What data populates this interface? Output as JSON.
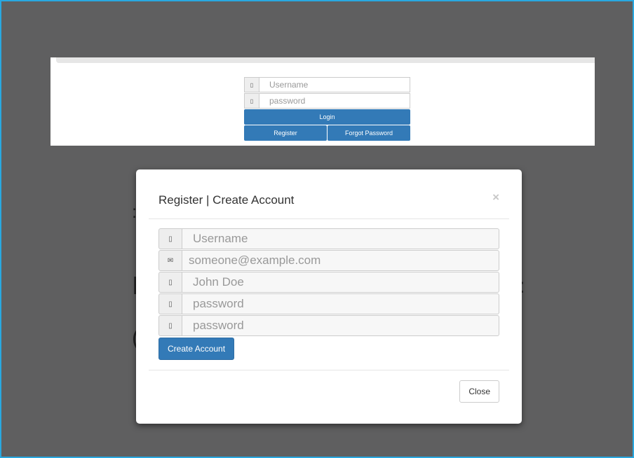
{
  "login": {
    "username_placeholder": "Username",
    "password_placeholder": "password",
    "login_label": "Login",
    "register_label": "Register",
    "forgot_label": "Forgot Password"
  },
  "modal": {
    "title": "Register | Create Account",
    "close_x": "×",
    "fields": {
      "username": "Username",
      "email": "someone@example.com",
      "fullname": "John Doe",
      "password": "password",
      "confirm_password": "password"
    },
    "icons": {
      "username": "user-icon",
      "email": "envelope-icon",
      "fullname": "user-icon",
      "password": "lock-icon",
      "confirm_password": "lock-icon"
    },
    "create_label": "Create Account",
    "close_label": "Close"
  },
  "colors": {
    "primary": "#337ab7",
    "backdrop": "#5f5f60",
    "frame_border": "#29a8e0"
  }
}
